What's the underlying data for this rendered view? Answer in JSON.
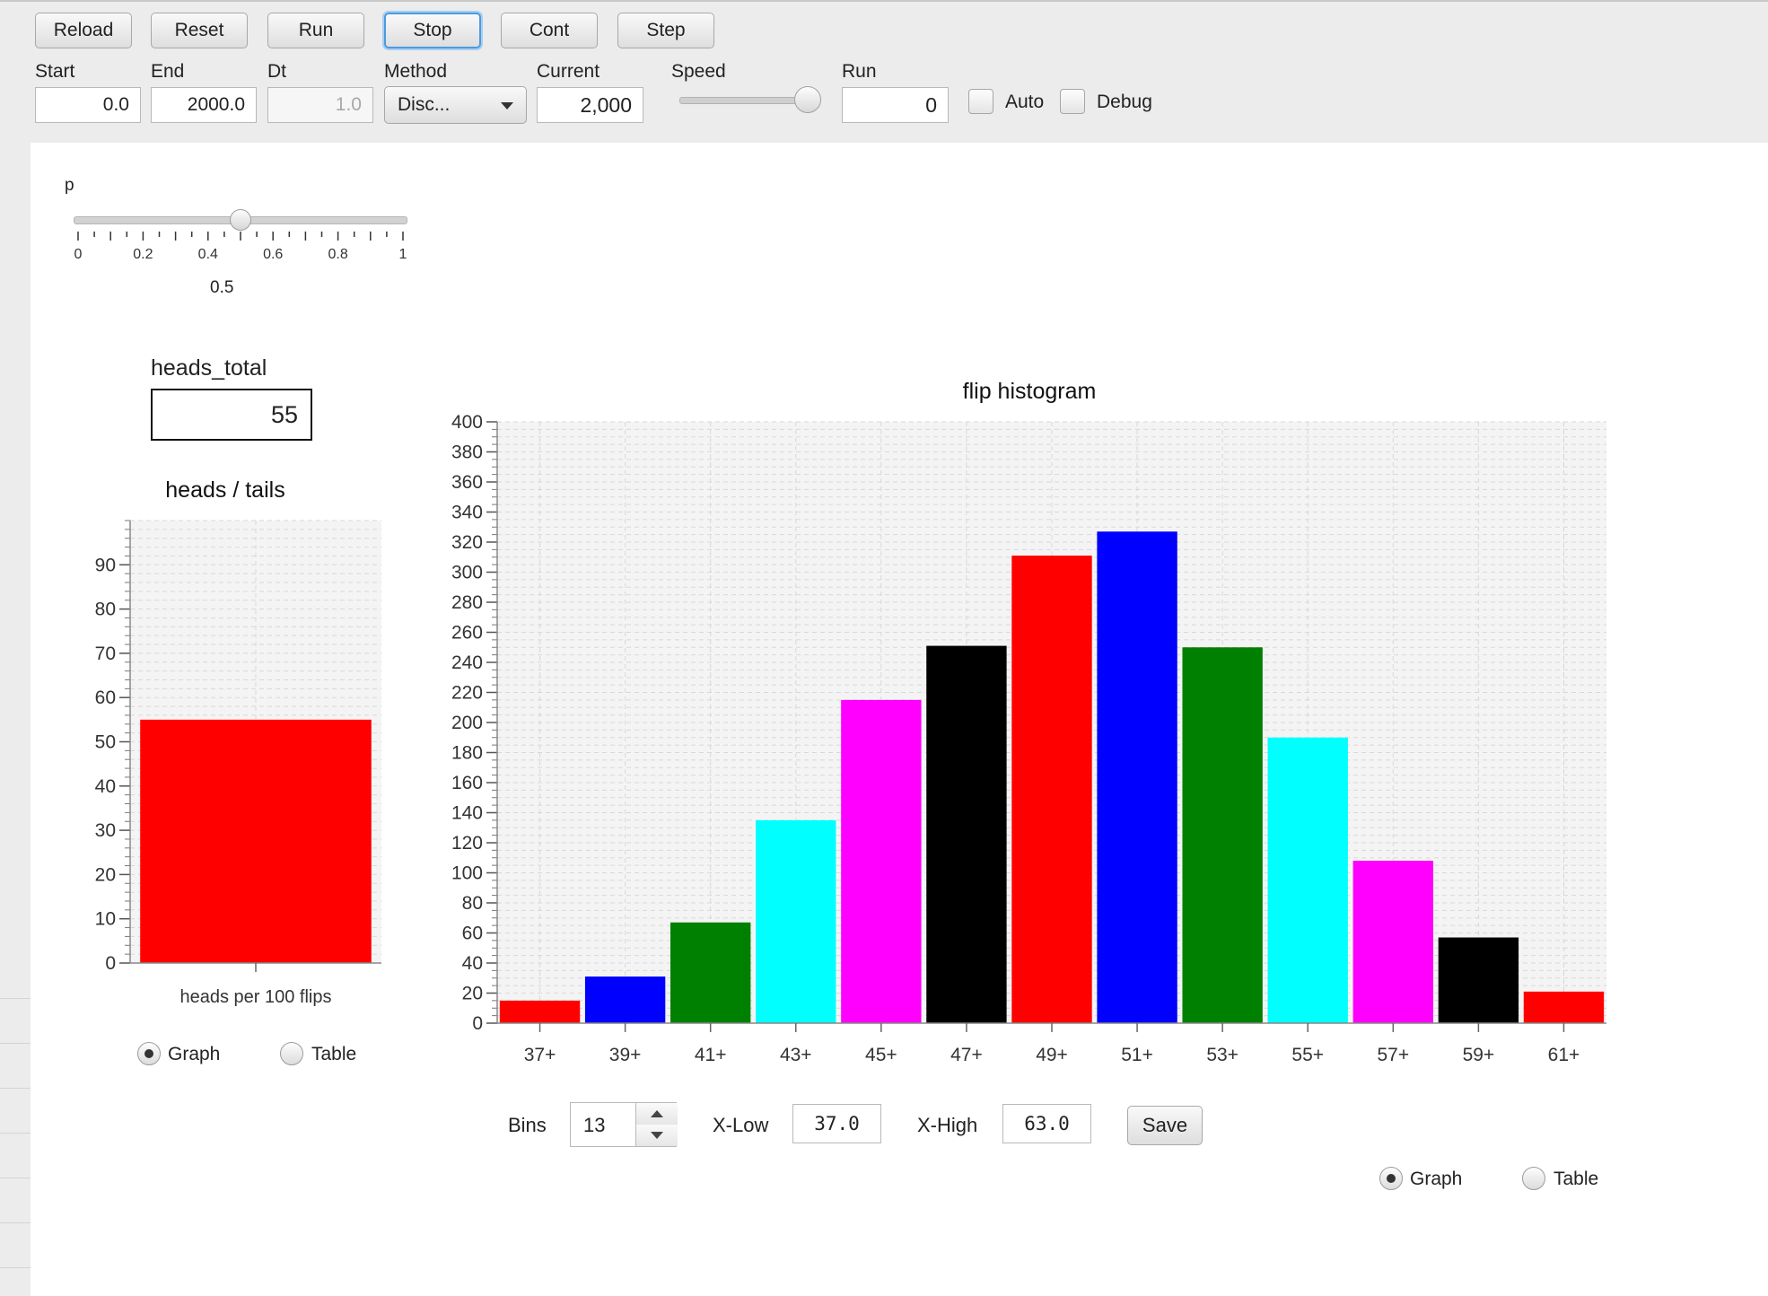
{
  "toolbar": {
    "buttons": [
      "Reload",
      "Reset",
      "Run",
      "Stop",
      "Cont",
      "Step"
    ],
    "start_label": "Start",
    "start_value": "0.0",
    "end_label": "End",
    "end_value": "2000.0",
    "dt_label": "Dt",
    "dt_value": "1.0",
    "method_label": "Method",
    "method_value": "Disc...",
    "current_label": "Current",
    "current_value": "2,000",
    "speed_label": "Speed",
    "speed_level": 0.95,
    "run_label": "Run",
    "run_value": "0",
    "auto_label": "Auto",
    "debug_label": "Debug"
  },
  "p_slider": {
    "label": "p",
    "value": 0.5,
    "min": 0,
    "max": 1,
    "ticks": [
      "0",
      "0.2",
      "0.4",
      "0.6",
      "0.8",
      "1"
    ],
    "value_text": "0.5"
  },
  "heads_total": {
    "label": "heads_total",
    "value": "55"
  },
  "left_view": {
    "graph_label": "Graph",
    "table_label": "Table",
    "selected": "Graph"
  },
  "right_view": {
    "graph_label": "Graph",
    "table_label": "Table",
    "selected": "Graph"
  },
  "hist_controls": {
    "bins_label": "Bins",
    "bins_value": "13",
    "xlow_label": "X-Low",
    "xlow_value": "37.0",
    "xhigh_label": "X-High",
    "xhigh_value": "63.0",
    "save_label": "Save"
  },
  "colors": {
    "red": "#ff0000",
    "blue": "#0000ff",
    "green": "#008000",
    "cyan": "#00ffff",
    "magenta": "#ff00ff",
    "black": "#000000"
  },
  "chart_data": [
    {
      "type": "bar",
      "title": "heads / tails",
      "categories": [
        "heads per 100 flips"
      ],
      "values": [
        55
      ],
      "colors": [
        "#ff0000"
      ],
      "ylim": [
        0,
        100
      ],
      "yticks": [
        0,
        10,
        20,
        30,
        40,
        50,
        60,
        70,
        80,
        90
      ],
      "grid": true
    },
    {
      "type": "bar",
      "title": "flip histogram",
      "categories": [
        "37+",
        "39+",
        "41+",
        "43+",
        "45+",
        "47+",
        "49+",
        "51+",
        "53+",
        "55+",
        "57+",
        "59+",
        "61+"
      ],
      "values": [
        15,
        31,
        67,
        135,
        215,
        251,
        311,
        327,
        250,
        190,
        108,
        57,
        21
      ],
      "colors": [
        "#ff0000",
        "#0000ff",
        "#008000",
        "#00ffff",
        "#ff00ff",
        "#000000",
        "#ff0000",
        "#0000ff",
        "#008000",
        "#00ffff",
        "#ff00ff",
        "#000000",
        "#ff0000"
      ],
      "ylim": [
        0,
        400
      ],
      "yticks": [
        0,
        20,
        40,
        60,
        80,
        100,
        120,
        140,
        160,
        180,
        200,
        220,
        240,
        260,
        280,
        300,
        320,
        340,
        360,
        380,
        400
      ],
      "grid": true
    }
  ]
}
